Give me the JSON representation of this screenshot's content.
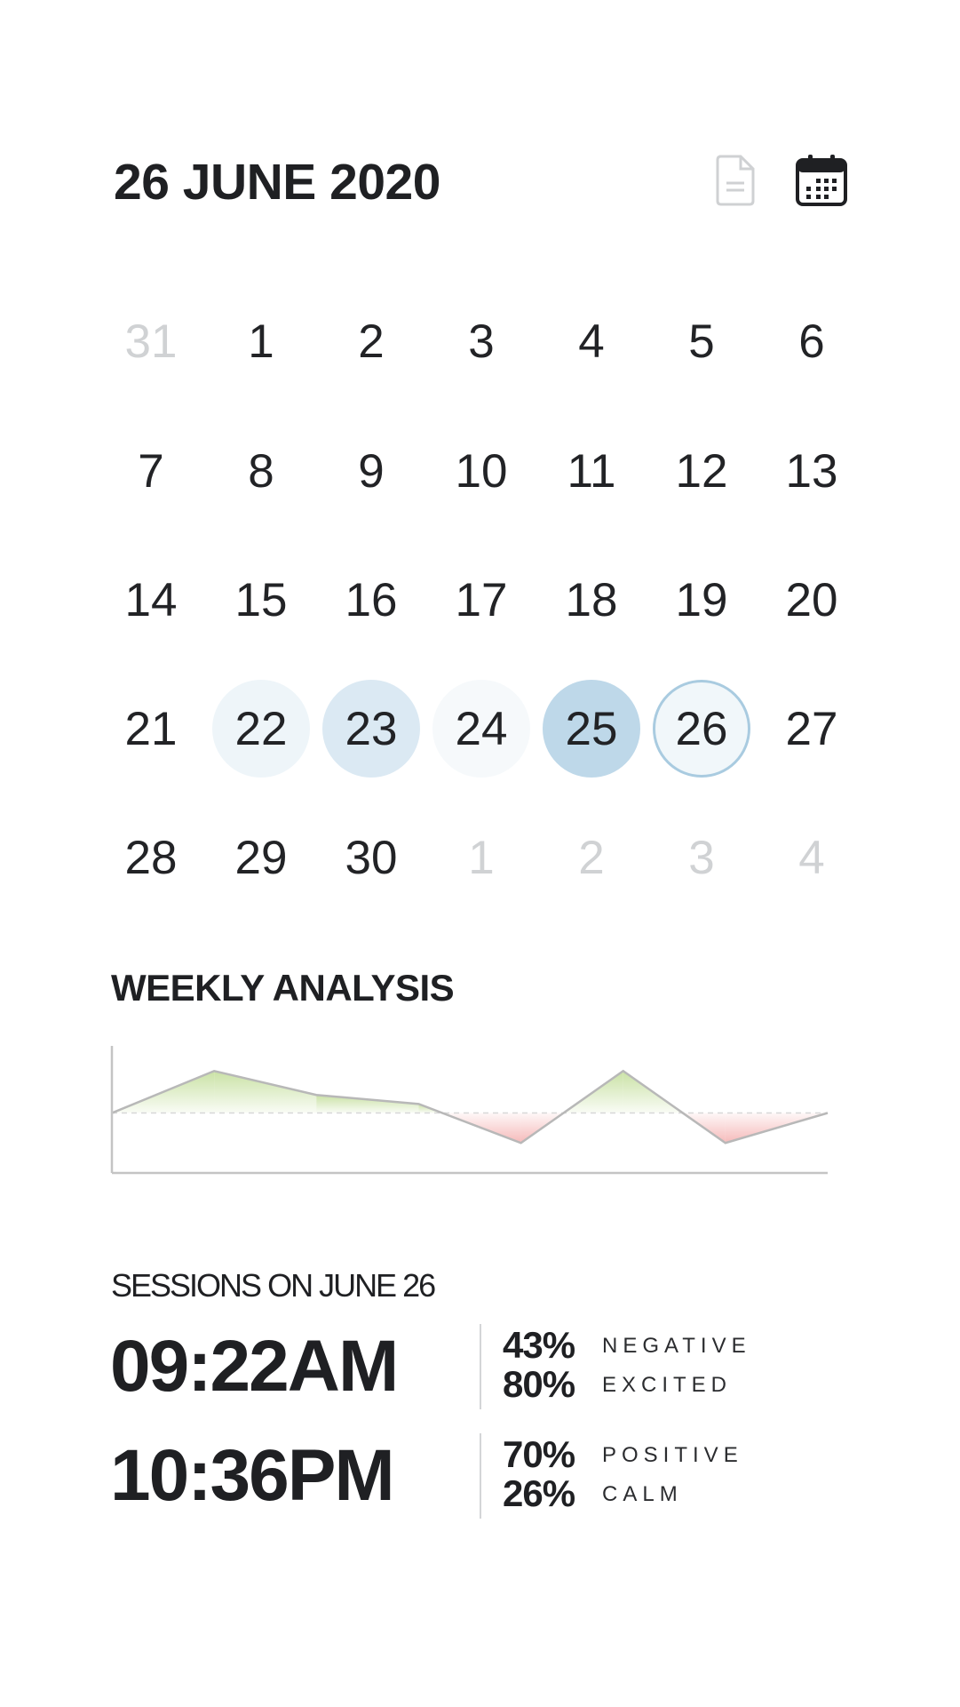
{
  "header": {
    "title": "26 JUNE 2020",
    "icons": [
      "document-icon",
      "calendar-icon"
    ]
  },
  "calendar": {
    "rows": [
      [
        "31",
        "1",
        "2",
        "3",
        "4",
        "5",
        "6"
      ],
      [
        "7",
        "8",
        "9",
        "10",
        "11",
        "12",
        "13"
      ],
      [
        "14",
        "15",
        "16",
        "17",
        "18",
        "19",
        "20"
      ],
      [
        "21",
        "22",
        "23",
        "24",
        "25",
        "26",
        "27"
      ],
      [
        "28",
        "29",
        "30",
        "1",
        "2",
        "3",
        "4"
      ]
    ],
    "muted": [
      [
        0,
        0
      ],
      [
        4,
        3
      ],
      [
        4,
        4
      ],
      [
        4,
        5
      ],
      [
        4,
        6
      ]
    ],
    "highlights": [
      {
        "row": 3,
        "col": 1,
        "color": "#eef5f9"
      },
      {
        "row": 3,
        "col": 2,
        "color": "#dbe9f3"
      },
      {
        "row": 3,
        "col": 3,
        "color": "#f6f9fb"
      },
      {
        "row": 3,
        "col": 4,
        "color": "#bed8e9"
      },
      {
        "row": 3,
        "col": 5,
        "color": "#f1f7fa",
        "ring": "#a9cbe0"
      }
    ]
  },
  "weekly": {
    "title": "WEEKLY ANALYSIS"
  },
  "chart_data": {
    "type": "area",
    "values": [
      0,
      1.4,
      0.6,
      0.3,
      -1,
      1.4,
      -1,
      0
    ],
    "ylim": [
      -2,
      2
    ],
    "baseline": 0,
    "positive_color": "#c7e0a0",
    "negative_color": "#f5b6b6",
    "line_color": "#b8b8b8",
    "title": "",
    "xlabel": "",
    "ylabel": ""
  },
  "sessions": {
    "title": "SESSIONS ON JUNE 26",
    "items": [
      {
        "time": "09:22AM",
        "metrics": [
          {
            "value": "43%",
            "label": "NEGATIVE"
          },
          {
            "value": "80%",
            "label": "EXCITED"
          }
        ]
      },
      {
        "time": "10:36PM",
        "metrics": [
          {
            "value": "70%",
            "label": "POSITIVE"
          },
          {
            "value": "26%",
            "label": "CALM"
          }
        ]
      }
    ]
  }
}
